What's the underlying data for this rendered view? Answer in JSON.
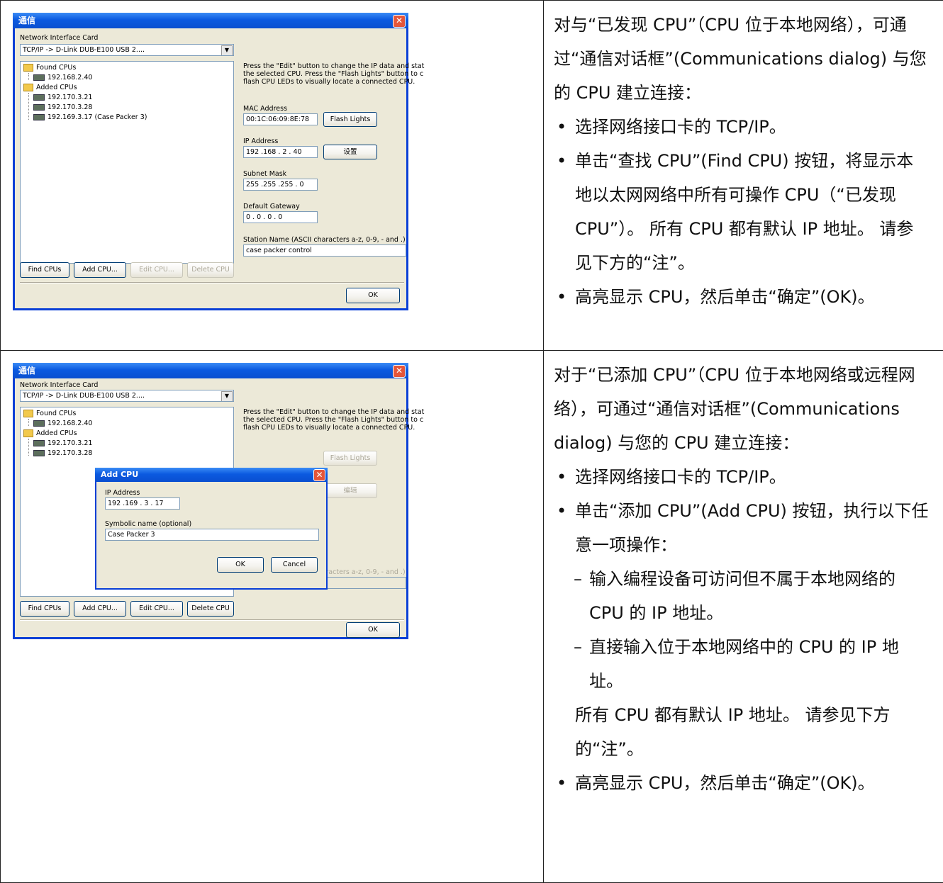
{
  "row1": {
    "dialog": {
      "title": "通信",
      "nic_label": "Network Interface Card",
      "nic_value": "TCP/IP -> D-Link DUB-E100 USB 2....",
      "tree": {
        "found_label": "Found CPUs",
        "found_items": [
          "192.168.2.40"
        ],
        "added_label": "Added CPUs",
        "added_items": [
          "192.170.3.21",
          "192.170.3.28",
          "192.169.3.17 (Case Packer 3)"
        ]
      },
      "hint_lines": [
        "Press the \"Edit\" button to change the IP data and stat",
        "the selected CPU. Press the \"Flash Lights\" button to c",
        "flash CPU LEDs to visually locate a connected CPU."
      ],
      "mac_label": "MAC Address",
      "mac_value": "00:1C:06:09:8E:78",
      "flash_label": "Flash Lights",
      "ip_label": "IP Address",
      "ip_value": "192 .168 . 2 . 40",
      "set_label": "设置",
      "subnet_label": "Subnet Mask",
      "subnet_value": "255 .255 .255 . 0",
      "gateway_label": "Default Gateway",
      "gateway_value": "0 . 0 . 0 . 0",
      "station_label": "Station Name (ASCII characters a-z, 0-9, - and .)",
      "station_value": "case packer control",
      "find_label": "Find CPUs",
      "add_label": "Add CPU...",
      "edit_label": "Edit CPU...",
      "delete_label": "Delete CPU",
      "ok_label": "OK"
    },
    "text": {
      "intro": "对与“已发现 CPU”（CPU 位于本地网络），可通过“通信对话框”(Communications dialog) 与您的 CPU 建立连接：",
      "bullets": [
        "选择网络接口卡的 TCP/IP。",
        "单击“查找 CPU”(Find CPU) 按钮，将显示本地以太网网络中所有可操作 CPU（“已发现 CPU”）。 所有 CPU 都有默认 IP 地址。 请参见下方的“注”。",
        "高亮显示 CPU，然后单击“确定”(OK)。"
      ]
    }
  },
  "row2": {
    "dialog": {
      "title": "通信",
      "nic_label": "Network Interface Card",
      "nic_value": "TCP/IP -> D-Link DUB-E100 USB 2....",
      "tree": {
        "found_label": "Found CPUs",
        "found_items": [
          "192.168.2.40"
        ],
        "added_label": "Added CPUs",
        "added_items": [
          "192.170.3.21",
          "192.170.3.28"
        ]
      },
      "hint_lines": [
        "Press the \"Edit\" button to change the IP data and stat",
        "the selected CPU. Press the \"Flash Lights\" button to c",
        "flash CPU LEDs to visually locate a connected CPU."
      ],
      "flash_label": "Flash Lights",
      "edit_btn_label": "编辑",
      "station_label": "Station Name (ASCII characters a-z, 0-9, - and .)",
      "find_label": "Find CPUs",
      "add_label": "Add CPU...",
      "edit_label": "Edit CPU...",
      "delete_label": "Delete CPU",
      "ok_label": "OK",
      "add_cpu": {
        "title": "Add CPU",
        "ip_label": "IP Address",
        "ip_value": "192 .169 . 3 . 17",
        "name_label": "Symbolic name (optional)",
        "name_value": "Case Packer 3",
        "ok_label": "OK",
        "cancel_label": "Cancel"
      }
    },
    "text": {
      "intro": "对于“已添加 CPU”（CPU 位于本地网络或远程网络），可通过“通信对话框”(Communications dialog) 与您的 CPU 建立连接：",
      "bullet1": "选择网络接口卡的 TCP/IP。",
      "bullet2": "单击“添加 CPU”(Add CPU) 按钮，执行以下任意一项操作：",
      "dashes": [
        "输入编程设备可访问但不属于本地网络的 CPU 的 IP 地址。",
        "直接输入位于本地网络中的 CPU 的 IP 地址。"
      ],
      "note": "所有 CPU 都有默认 IP 地址。 请参见下方的“注”。",
      "bullet3": "高亮显示 CPU，然后单击“确定”(OK)。"
    }
  }
}
